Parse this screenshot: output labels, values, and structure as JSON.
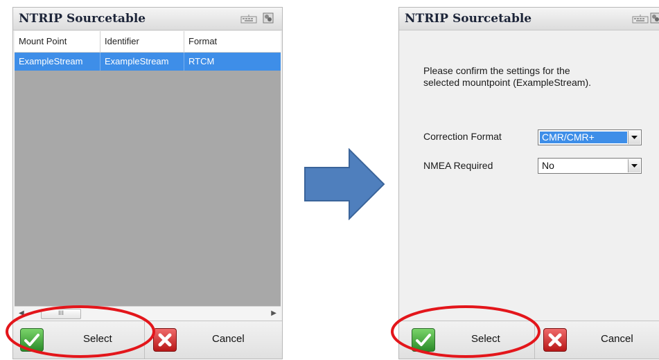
{
  "left_window": {
    "title": "NTRIP Sourcetable",
    "table": {
      "columns": [
        "Mount Point",
        "Identifier",
        "Format"
      ],
      "rows": [
        {
          "mount_point": "ExampleStream",
          "identifier": "ExampleStream",
          "format": "RTCM",
          "selected": true
        }
      ]
    },
    "scrollbar_thumb_glyph": "III",
    "select_label": "Select",
    "cancel_label": "Cancel"
  },
  "right_window": {
    "title": "NTRIP Sourcetable",
    "message_line1": "Please confirm the settings for the",
    "message_line2": "selected mountpoint (ExampleStream).",
    "correction_format": {
      "label": "Correction Format",
      "value": "CMR/CMR+"
    },
    "nmea_required": {
      "label": "NMEA Required",
      "value": "No"
    },
    "select_label": "Select",
    "cancel_label": "Cancel"
  },
  "colors": {
    "selection": "#3e8ee8",
    "arrow": "#4f7fbd",
    "annotation": "#e3161b"
  }
}
